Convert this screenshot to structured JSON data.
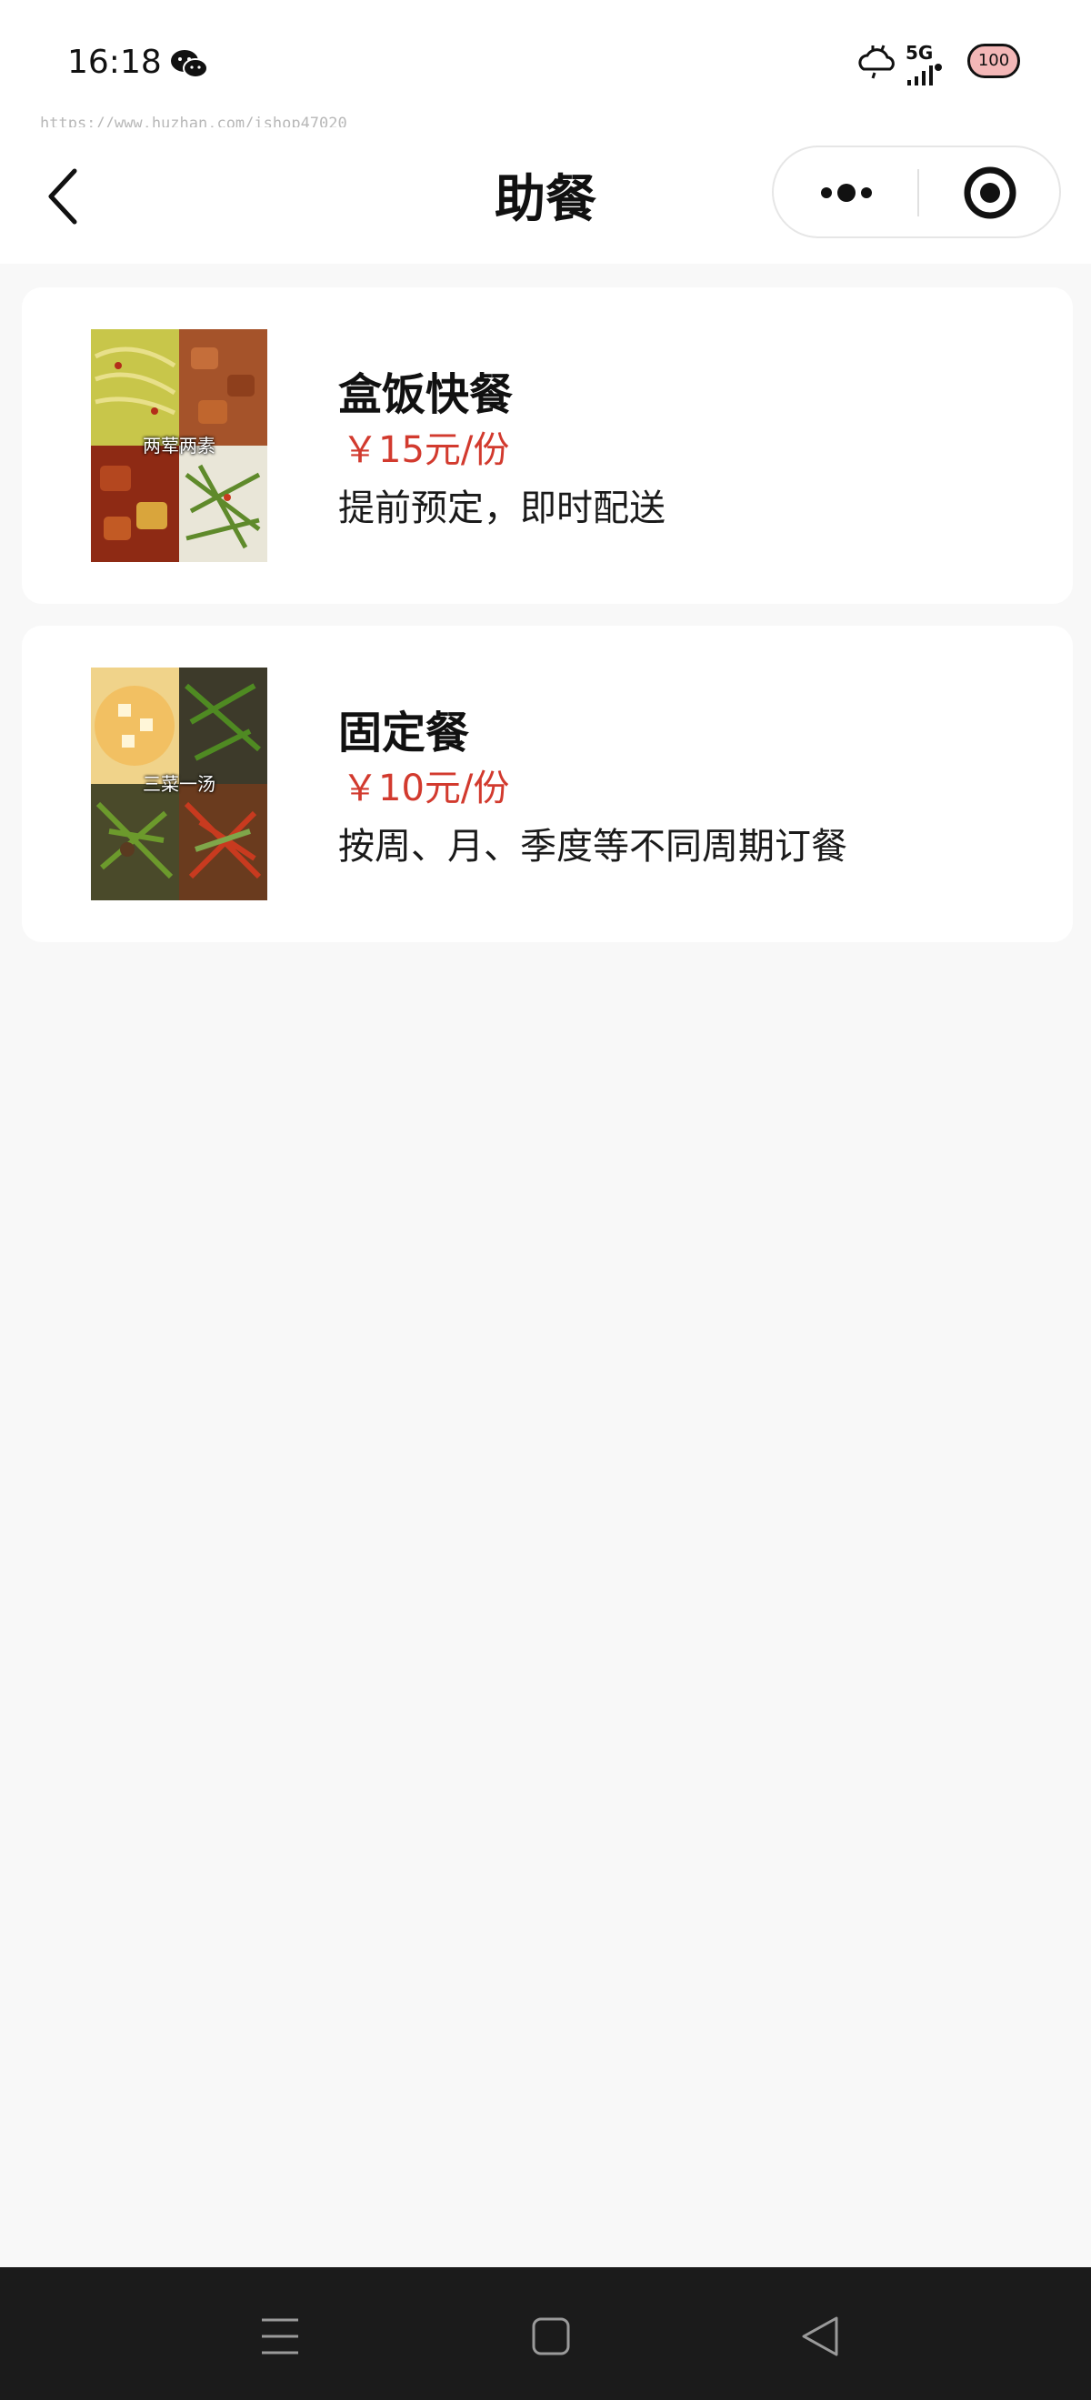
{
  "status_bar": {
    "time": "16:18",
    "network": "5G",
    "battery": "100",
    "icons": [
      "wechat-icon",
      "weather-icon",
      "signal-icon",
      "battery-icon"
    ]
  },
  "watermark_url": "https://www.huzhan.com/ishop47020",
  "nav": {
    "title": "助餐",
    "icons": [
      "back-icon",
      "more-icon",
      "close-target-icon"
    ]
  },
  "items": [
    {
      "image_caption": "两荤两素",
      "title": "盒饭快餐",
      "price": "￥15元/份",
      "desc": "提前预定，即时配送"
    },
    {
      "image_caption": "三菜一汤",
      "title": "固定餐",
      "price": "￥10元/份",
      "desc": "按周、月、季度等不同周期订餐"
    }
  ],
  "colors": {
    "price": "#d23a2e",
    "page_bg": "#f8f8f8",
    "system_nav_bg": "#1b1b1b"
  },
  "system_nav": {
    "icons": [
      "menu-icon",
      "home-icon",
      "back-triangle-icon"
    ]
  }
}
